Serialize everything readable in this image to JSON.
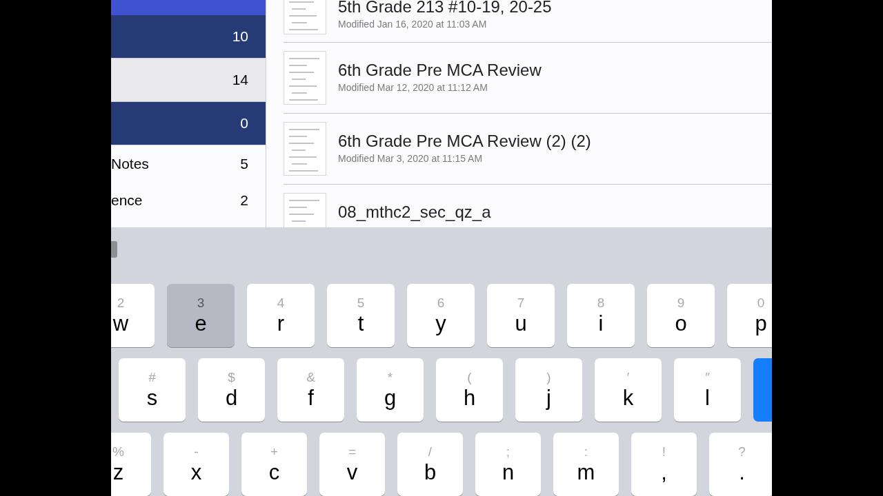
{
  "sidebar": {
    "items": [
      {
        "count": "10",
        "kind": "dark"
      },
      {
        "count": "14",
        "kind": "grey"
      },
      {
        "count": "0",
        "kind": "dark"
      },
      {
        "label": "Notes",
        "count": "5",
        "kind": "plain"
      },
      {
        "label": "ence",
        "count": "2",
        "kind": "plain"
      }
    ]
  },
  "files": [
    {
      "title": "5th Grade 213 #10-19, 20-25",
      "modified": "Modified Jan 16, 2020 at 11:03 AM"
    },
    {
      "title": "6th Grade Pre MCA Review",
      "modified": "Modified Mar 12, 2020 at 11:12 AM"
    },
    {
      "title": "6th Grade Pre MCA Review (2) (2)",
      "modified": "Modified Mar 3, 2020 at 11:15 AM"
    },
    {
      "title": "08_mthc2_sec_qz_a"
    }
  ],
  "keyboard": {
    "rows": [
      [
        {
          "kind": "letter",
          "label": "w",
          "secondary": "2",
          "pressed": false
        },
        {
          "kind": "letter",
          "label": "e",
          "secondary": "3",
          "pressed": true
        },
        {
          "kind": "letter",
          "label": "r",
          "secondary": "4",
          "pressed": false
        },
        {
          "kind": "letter",
          "label": "t",
          "secondary": "5",
          "pressed": false
        },
        {
          "kind": "letter",
          "label": "y",
          "secondary": "6",
          "pressed": false
        },
        {
          "kind": "letter",
          "label": "u",
          "secondary": "7",
          "pressed": false
        },
        {
          "kind": "letter",
          "label": "i",
          "secondary": "8",
          "pressed": false
        },
        {
          "kind": "letter",
          "label": "o",
          "secondary": "9",
          "pressed": false
        },
        {
          "kind": "letter",
          "label": "p",
          "secondary": "0",
          "pressed": false
        }
      ],
      [
        {
          "kind": "letter",
          "label": "s",
          "secondary": "#",
          "pressed": false
        },
        {
          "kind": "letter",
          "label": "d",
          "secondary": "$",
          "pressed": false
        },
        {
          "kind": "letter",
          "label": "f",
          "secondary": "&",
          "pressed": false
        },
        {
          "kind": "letter",
          "label": "g",
          "secondary": "*",
          "pressed": false
        },
        {
          "kind": "letter",
          "label": "h",
          "secondary": "(",
          "pressed": false
        },
        {
          "kind": "letter",
          "label": "j",
          "secondary": ")",
          "pressed": false
        },
        {
          "kind": "letter",
          "label": "k",
          "secondary": "′",
          "pressed": false
        },
        {
          "kind": "letter",
          "label": "l",
          "secondary": "″",
          "pressed": false
        },
        {
          "kind": "action",
          "pressed": false
        }
      ],
      [
        {
          "kind": "letter",
          "label": "z",
          "secondary": "%",
          "pressed": false
        },
        {
          "kind": "letter",
          "label": "x",
          "secondary": "-",
          "pressed": false
        },
        {
          "kind": "letter",
          "label": "c",
          "secondary": "+",
          "pressed": false
        },
        {
          "kind": "letter",
          "label": "v",
          "secondary": "=",
          "pressed": false
        },
        {
          "kind": "letter",
          "label": "b",
          "secondary": "/",
          "pressed": false
        },
        {
          "kind": "letter",
          "label": "n",
          "secondary": ";",
          "pressed": false
        },
        {
          "kind": "letter",
          "label": "m",
          "secondary": ":",
          "pressed": false
        },
        {
          "kind": "letter",
          "label": ",",
          "secondary": "!",
          "pressed": false
        },
        {
          "kind": "letter",
          "label": ".",
          "secondary": "?",
          "pressed": false
        }
      ]
    ]
  }
}
